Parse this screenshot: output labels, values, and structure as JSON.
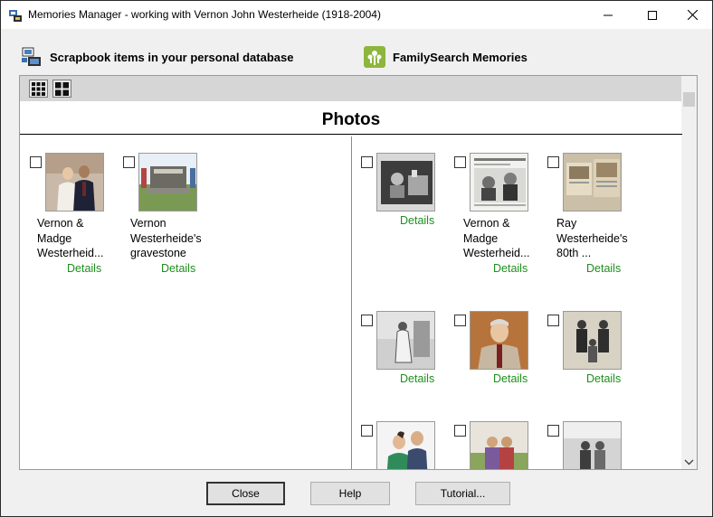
{
  "window": {
    "title": "Memories Manager - working with Vernon John Westerheide (1918-2004)"
  },
  "headers": {
    "scrapbook": "Scrapbook items in your personal database",
    "familysearch": "FamilySearch Memories"
  },
  "panel": {
    "title": "Photos"
  },
  "left_items": [
    {
      "caption": "Vernon & Madge Westerheid...",
      "details": "Details"
    },
    {
      "caption": "Vernon Westerheide's gravestone",
      "details": "Details"
    }
  ],
  "right_items": [
    {
      "caption": "",
      "details": "Details"
    },
    {
      "caption": "Vernon & Madge Westerheid...",
      "details": "Details"
    },
    {
      "caption": "Ray Westerheide's 80th ...",
      "details": "Details"
    },
    {
      "caption": "",
      "details": "Details"
    },
    {
      "caption": "",
      "details": "Details"
    },
    {
      "caption": "",
      "details": "Details"
    },
    {
      "caption": "",
      "details": ""
    },
    {
      "caption": "",
      "details": ""
    },
    {
      "caption": "",
      "details": ""
    }
  ],
  "buttons": {
    "close": "Close",
    "help": "Help",
    "tutorial": "Tutorial..."
  }
}
